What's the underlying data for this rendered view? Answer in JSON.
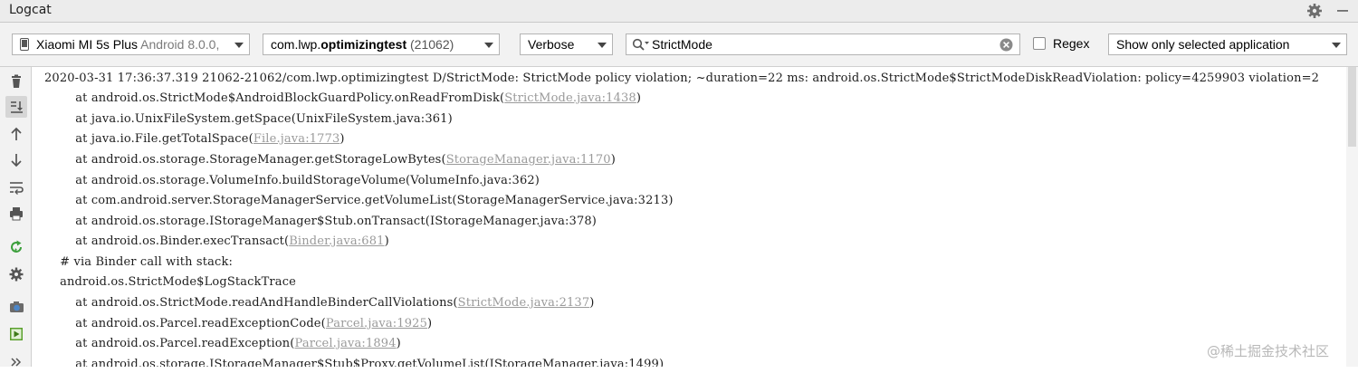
{
  "window": {
    "title": "Logcat"
  },
  "toolbar": {
    "device": {
      "name": "Xiaomi MI 5s Plus",
      "version": "Android 8.0.0,"
    },
    "package": {
      "prefix": "com.lwp.",
      "bold": "optimizingtest",
      "pid": " (21062)"
    },
    "log_level": "Verbose",
    "search_value": "StrictMode",
    "regex_label": "Regex",
    "regex_checked": false,
    "filter": "Show only selected application"
  },
  "sidebar": {
    "items": [
      {
        "icon": "trash-icon",
        "label": "Clear logcat"
      },
      {
        "icon": "scroll-to-end-icon",
        "label": "Scroll to the end",
        "active": true
      },
      {
        "icon": "arrow-up-icon",
        "label": "Up the stack trace"
      },
      {
        "icon": "arrow-down-icon",
        "label": "Down the stack trace"
      },
      {
        "icon": "soft-wrap-icon",
        "label": "Use soft wraps"
      },
      {
        "icon": "print-icon",
        "label": "Print"
      },
      {
        "icon": "restart-icon",
        "label": "Restart"
      },
      {
        "icon": "settings-icon",
        "label": "Logcat header"
      },
      {
        "icon": "camera-icon",
        "label": "Screen capture"
      },
      {
        "icon": "screen-record-icon",
        "label": "Screen record"
      },
      {
        "icon": "more-icon",
        "label": "More"
      }
    ]
  },
  "log_lines": [
    {
      "text": "2020-03-31 17:36:37.319 21062-21062/com.lwp.optimizingtest D/StrictMode: StrictMode policy violation; ~duration=22 ms: android.os.StrictMode$StrictModeDiskReadViolation: policy=4259903 violation=2",
      "link": "",
      "after": ""
    },
    {
      "text": "        at android.os.StrictMode$AndroidBlockGuardPolicy.onReadFromDisk(",
      "link": "StrictMode.java:1438",
      "after": ")"
    },
    {
      "text": "        at java.io.UnixFileSystem.getSpace(UnixFileSystem.java:361)",
      "link": "",
      "after": ""
    },
    {
      "text": "        at java.io.File.getTotalSpace(",
      "link": "File.java:1773",
      "after": ")"
    },
    {
      "text": "        at android.os.storage.StorageManager.getStorageLowBytes(",
      "link": "StorageManager.java:1170",
      "after": ")"
    },
    {
      "text": "        at android.os.storage.VolumeInfo.buildStorageVolume(VolumeInfo.java:362)",
      "link": "",
      "after": ""
    },
    {
      "text": "        at com.android.server.StorageManagerService.getVolumeList(StorageManagerService.java:3213)",
      "link": "",
      "after": ""
    },
    {
      "text": "        at android.os.storage.IStorageManager$Stub.onTransact(IStorageManager.java:378)",
      "link": "",
      "after": ""
    },
    {
      "text": "        at android.os.Binder.execTransact(",
      "link": "Binder.java:681",
      "after": ")"
    },
    {
      "text": "    # via Binder call with stack:",
      "link": "",
      "after": ""
    },
    {
      "text": "    android.os.StrictMode$LogStackTrace",
      "link": "",
      "after": ""
    },
    {
      "text": "        at android.os.StrictMode.readAndHandleBinderCallViolations(",
      "link": "StrictMode.java:2137",
      "after": ")"
    },
    {
      "text": "        at android.os.Parcel.readExceptionCode(",
      "link": "Parcel.java:1925",
      "after": ")"
    },
    {
      "text": "        at android.os.Parcel.readException(",
      "link": "Parcel.java:1894",
      "after": ")"
    },
    {
      "text": "        at android.os.storage.IStorageManager$Stub$Proxy.getVolumeList(IStorageManager.java:1499)",
      "link": "",
      "after": ""
    }
  ],
  "watermark": "@稀土掘金技术社区",
  "colors": {
    "link": "#9a9a9a",
    "restart_icon": "#3b9f3b",
    "record_icon": "#5aa02c",
    "camera_icon": "#4c87c9"
  }
}
